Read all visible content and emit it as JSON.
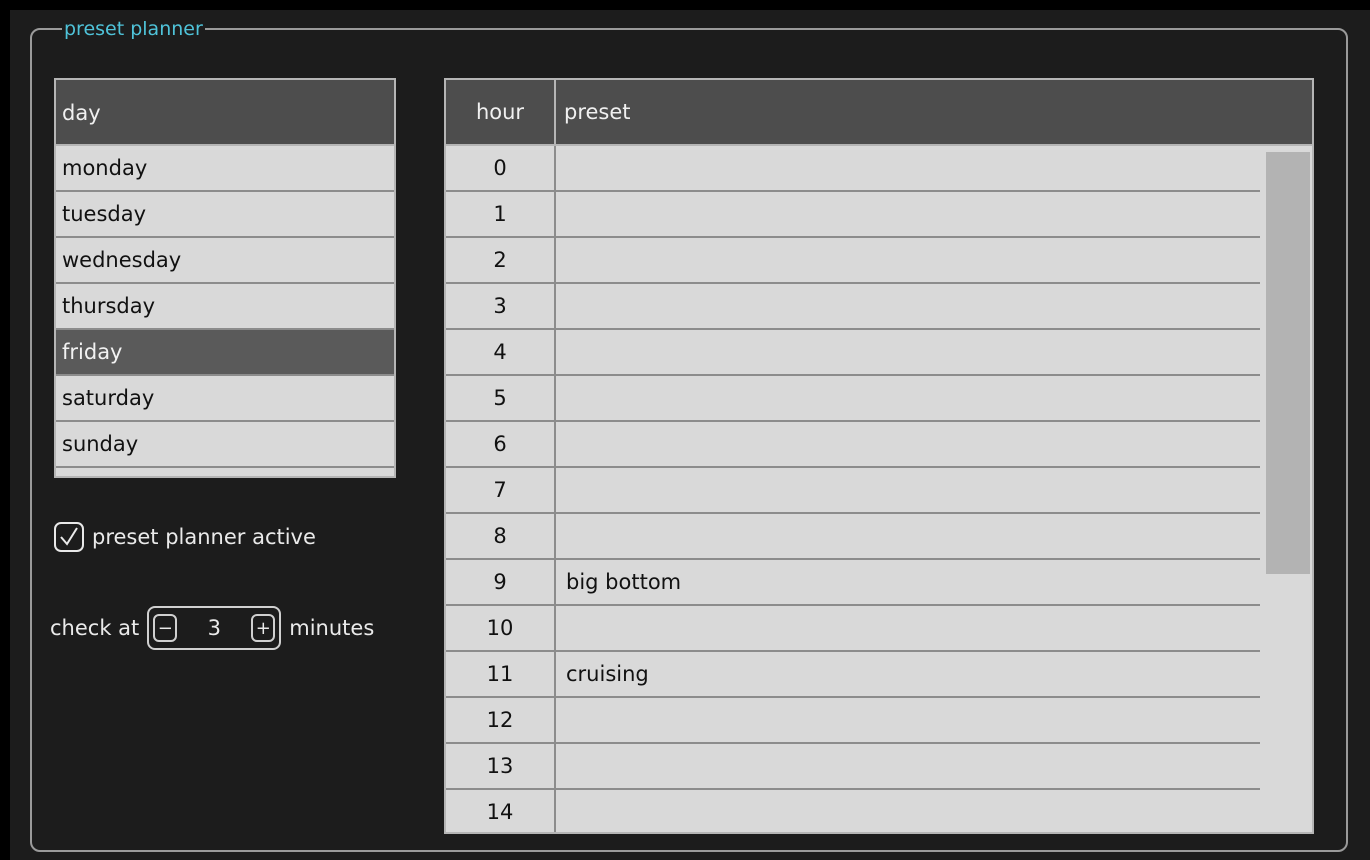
{
  "panel": {
    "title": "preset planner"
  },
  "day_table": {
    "header": "day",
    "days": [
      "monday",
      "tuesday",
      "wednesday",
      "thursday",
      "friday",
      "saturday",
      "sunday"
    ],
    "selected_index": 4
  },
  "active_checkbox": {
    "label": "preset planner active",
    "checked": true
  },
  "check_interval": {
    "prefix": "check at",
    "value": "3",
    "suffix": "minutes",
    "minus_label": "−",
    "plus_label": "+"
  },
  "hour_table": {
    "header_hour": "hour",
    "header_preset": "preset",
    "rows": [
      {
        "hour": "0",
        "preset": ""
      },
      {
        "hour": "1",
        "preset": ""
      },
      {
        "hour": "2",
        "preset": ""
      },
      {
        "hour": "3",
        "preset": ""
      },
      {
        "hour": "4",
        "preset": ""
      },
      {
        "hour": "5",
        "preset": ""
      },
      {
        "hour": "6",
        "preset": ""
      },
      {
        "hour": "7",
        "preset": ""
      },
      {
        "hour": "8",
        "preset": ""
      },
      {
        "hour": "9",
        "preset": "big bottom"
      },
      {
        "hour": "10",
        "preset": ""
      },
      {
        "hour": "11",
        "preset": "cruising"
      },
      {
        "hour": "12",
        "preset": ""
      },
      {
        "hour": "13",
        "preset": ""
      },
      {
        "hour": "14",
        "preset": ""
      }
    ]
  },
  "colors": {
    "title_accent": "#4fc3d9",
    "header_bg": "#4d4d4d",
    "row_bg": "#d9d9d9",
    "selected_bg": "#5a5a5a"
  }
}
